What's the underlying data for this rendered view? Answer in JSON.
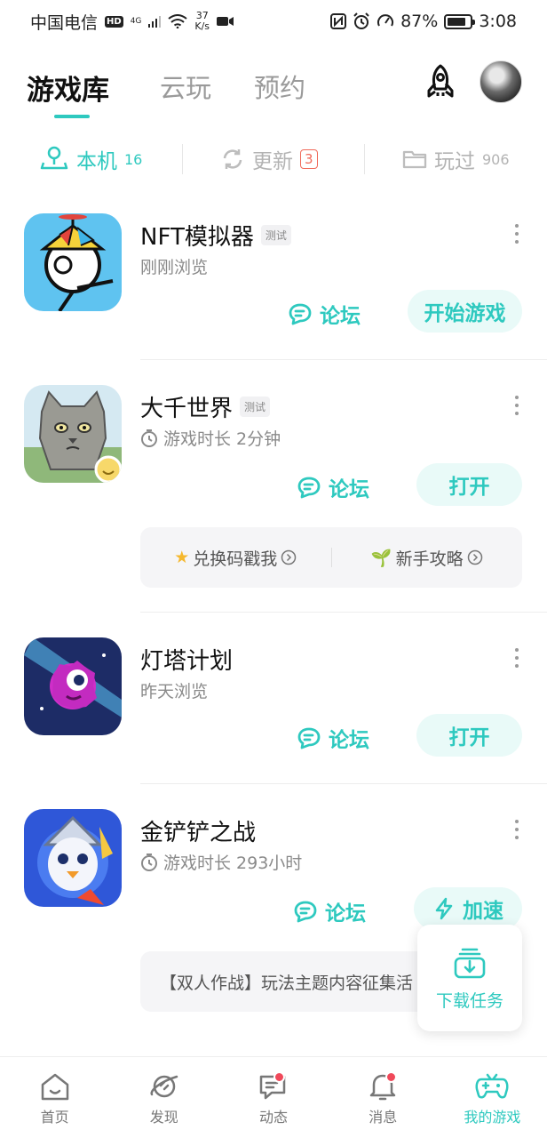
{
  "status_bar": {
    "carrier": "中国电信",
    "hd": "HD",
    "signal_label": "4G",
    "speed_value": "37",
    "speed_unit": "K/s",
    "battery": "87%",
    "time": "3:08"
  },
  "top_tabs": [
    {
      "label": "游戏库",
      "active": true
    },
    {
      "label": "云玩",
      "active": false
    },
    {
      "label": "预约",
      "active": false
    }
  ],
  "sub_tabs": [
    {
      "label": "本机",
      "count": "16",
      "active": true
    },
    {
      "label": "更新",
      "count": "3",
      "active": false
    },
    {
      "label": "玩过",
      "count": "906",
      "active": false
    }
  ],
  "games": [
    {
      "name": "NFT模拟器",
      "tag": "测试",
      "sub": "刚刚浏览",
      "forum": "论坛",
      "action": "开始游戏"
    },
    {
      "name": "大千世界",
      "tag": "测试",
      "sub": "游戏时长 2分钟",
      "forum": "论坛",
      "action": "打开",
      "banner": {
        "left": "兑换码戳我",
        "right": "新手攻略"
      }
    },
    {
      "name": "灯塔计划",
      "sub": "昨天浏览",
      "forum": "论坛",
      "action": "打开"
    },
    {
      "name": "金铲铲之战",
      "sub": "游戏时长 293小时",
      "forum": "论坛",
      "action": "加速",
      "banner": {
        "text": "【双人作战】玩法主题内容征集活"
      }
    }
  ],
  "download_popup": {
    "label": "下载任务"
  },
  "bottom_nav": [
    {
      "label": "首页",
      "icon": "home-icon"
    },
    {
      "label": "发现",
      "icon": "planet-icon"
    },
    {
      "label": "动态",
      "icon": "chat-icon",
      "dot": true
    },
    {
      "label": "消息",
      "icon": "bell-icon",
      "dot": true
    },
    {
      "label": "我的游戏",
      "icon": "gamepad-icon",
      "active": true
    }
  ],
  "colors": {
    "accent": "#2ec9bf",
    "badge": "#f06a5a",
    "dot": "#f0495a"
  }
}
